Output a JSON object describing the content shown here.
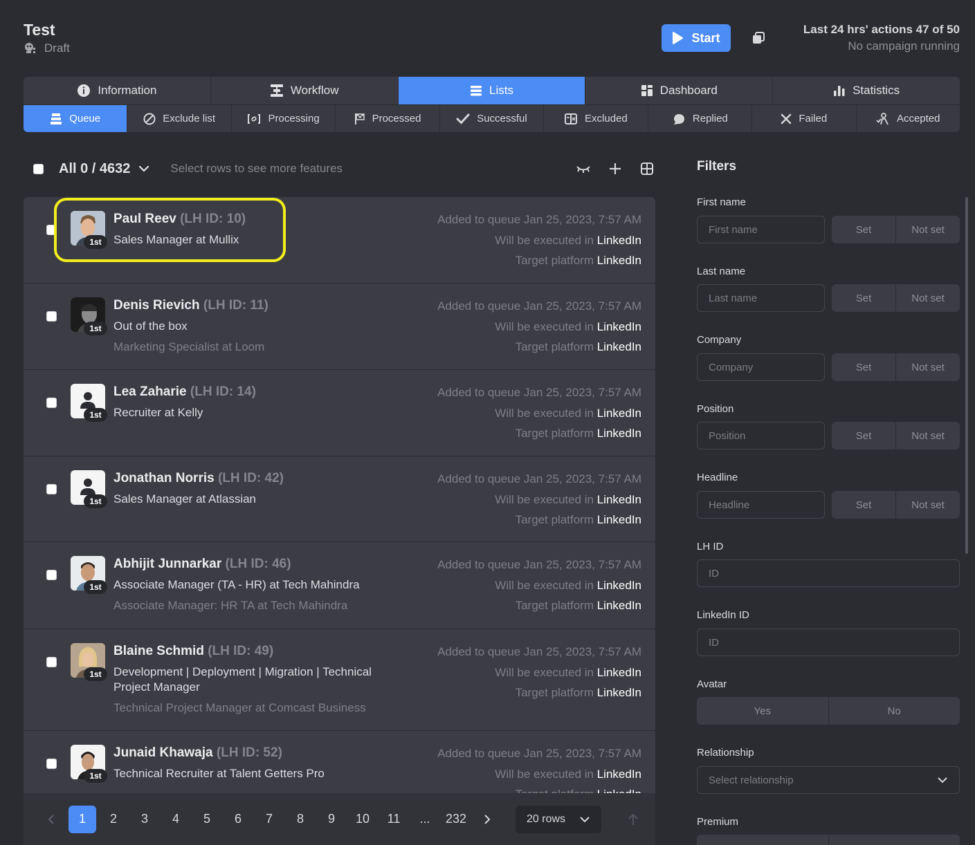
{
  "header": {
    "title": "Test",
    "status": "Draft",
    "start_label": "Start",
    "actions_line": "Last 24 hrs' actions 47 of 50",
    "campaign_line": "No campaign running"
  },
  "main_tabs": [
    {
      "label": "Information"
    },
    {
      "label": "Workflow"
    },
    {
      "label": "Lists"
    },
    {
      "label": "Dashboard"
    },
    {
      "label": "Statistics"
    }
  ],
  "sub_tabs": [
    {
      "label": "Queue"
    },
    {
      "label": "Exclude list"
    },
    {
      "label": "Processing"
    },
    {
      "label": "Processed"
    },
    {
      "label": "Successful"
    },
    {
      "label": "Excluded"
    },
    {
      "label": "Replied"
    },
    {
      "label": "Failed"
    },
    {
      "label": "Accepted"
    }
  ],
  "toolbar": {
    "all_label": "All 0 / 4632",
    "hint": "Select rows to see more features"
  },
  "rows": [
    {
      "name": "Paul Reev",
      "lhid": "(LH ID: 10)",
      "line1": "Sales Manager at Mullix",
      "line2": "",
      "degree": "1st",
      "added": "Added to queue Jan 25, 2023, 7:57 AM",
      "exec_prefix": "Will be executed in",
      "exec_value": "LinkedIn",
      "target_prefix": "Target platform",
      "target_value": "LinkedIn"
    },
    {
      "name": "Denis Rievich",
      "lhid": "(LH ID: 11)",
      "line1": "Out of the box",
      "line2": "Marketing Specialist at Loom",
      "degree": "1st",
      "added": "Added to queue Jan 25, 2023, 7:57 AM",
      "exec_prefix": "Will be executed in",
      "exec_value": "LinkedIn",
      "target_prefix": "Target platform",
      "target_value": "LinkedIn"
    },
    {
      "name": "Lea Zaharie",
      "lhid": "(LH ID: 14)",
      "line1": "Recruiter at Kelly",
      "line2": "",
      "degree": "1st",
      "added": "Added to queue Jan 25, 2023, 7:57 AM",
      "exec_prefix": "Will be executed in",
      "exec_value": "LinkedIn",
      "target_prefix": "Target platform",
      "target_value": "LinkedIn"
    },
    {
      "name": "Jonathan Norris",
      "lhid": "(LH ID: 42)",
      "line1": "Sales Manager at Atlassian",
      "line2": "",
      "degree": "1st",
      "added": "Added to queue Jan 25, 2023, 7:57 AM",
      "exec_prefix": "Will be executed in",
      "exec_value": "LinkedIn",
      "target_prefix": "Target platform",
      "target_value": "LinkedIn"
    },
    {
      "name": "Abhijit Junnarkar",
      "lhid": "(LH ID: 46)",
      "line1": "Associate Manager (TA - HR) at Tech Mahindra",
      "line2": "Associate Manager: HR TA at Tech Mahindra",
      "degree": "1st",
      "added": "Added to queue Jan 25, 2023, 7:57 AM",
      "exec_prefix": "Will be executed in",
      "exec_value": "LinkedIn",
      "target_prefix": "Target platform",
      "target_value": "LinkedIn"
    },
    {
      "name": "Blaine Schmid",
      "lhid": "(LH ID: 49)",
      "line1": "Development | Deployment | Migration | Technical Project Manager",
      "line2": "Technical Project Manager at Comcast Business",
      "degree": "1st",
      "added": "Added to queue Jan 25, 2023, 7:57 AM",
      "exec_prefix": "Will be executed in",
      "exec_value": "LinkedIn",
      "target_prefix": "Target platform",
      "target_value": "LinkedIn"
    },
    {
      "name": "Junaid Khawaja",
      "lhid": "(LH ID: 52)",
      "line1": "Technical Recruiter at Talent Getters Pro",
      "line2": "",
      "degree": "1st",
      "added": "Added to queue Jan 25, 2023, 7:57 AM",
      "exec_prefix": "Will be executed in",
      "exec_value": "LinkedIn",
      "target_prefix": "Target platform",
      "target_value": "LinkedIn"
    }
  ],
  "pagination": {
    "pages": [
      "1",
      "2",
      "3",
      "4",
      "5",
      "6",
      "7",
      "8",
      "9",
      "10",
      "11",
      "...",
      "232"
    ],
    "rows_label": "20 rows"
  },
  "filters": {
    "title": "Filters",
    "first_name": {
      "label": "First name",
      "placeholder": "First name"
    },
    "last_name": {
      "label": "Last name",
      "placeholder": "Last name"
    },
    "company": {
      "label": "Company",
      "placeholder": "Company"
    },
    "position": {
      "label": "Position",
      "placeholder": "Position"
    },
    "headline": {
      "label": "Headline",
      "placeholder": "Headline"
    },
    "lh_id": {
      "label": "LH ID",
      "placeholder": "ID"
    },
    "linkedin_id": {
      "label": "LinkedIn ID",
      "placeholder": "ID"
    },
    "avatar": {
      "label": "Avatar",
      "yes": "Yes",
      "no": "No"
    },
    "relationship": {
      "label": "Relationship",
      "placeholder": "Select relationship"
    },
    "premium": {
      "label": "Premium"
    },
    "set_label": "Set",
    "not_set_label": "Not set"
  },
  "colors": {
    "accent": "#4c8cf5",
    "highlight": "#f2ee1e",
    "background": "#2b2c31"
  }
}
